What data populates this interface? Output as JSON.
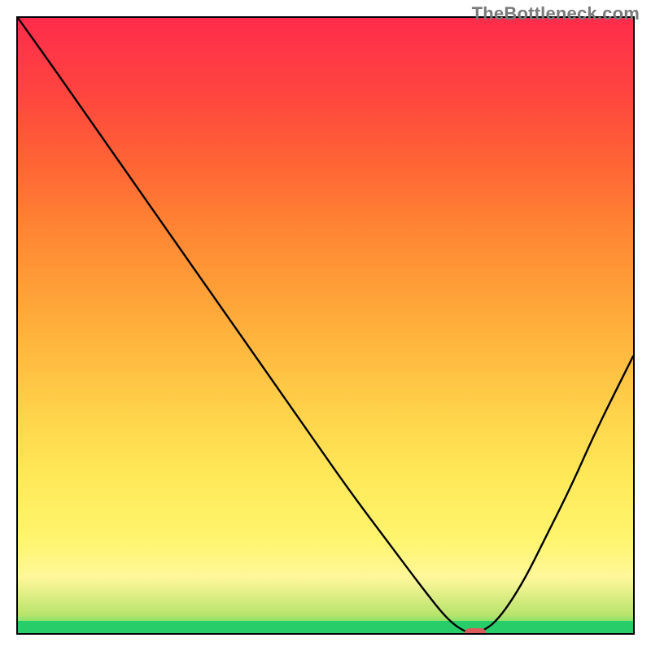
{
  "watermark": "TheBottleneck.com",
  "chart_data": {
    "type": "line",
    "title": "",
    "xlabel": "",
    "ylabel": "",
    "xlim": [
      0,
      100
    ],
    "ylim": [
      0,
      100
    ],
    "grid": false,
    "series": [
      {
        "name": "bottleneck-curve",
        "x": [
          0,
          5,
          12,
          19,
          26,
          33,
          40,
          47,
          54,
          60,
          66,
          70,
          73,
          75,
          78,
          82,
          86,
          90,
          94,
          100
        ],
        "values": [
          100,
          93,
          83,
          73,
          63,
          53,
          43,
          33,
          23,
          15,
          7,
          2,
          0,
          0,
          2,
          8,
          16,
          24,
          33,
          45
        ]
      }
    ],
    "marker": {
      "x": 74,
      "y": 0.5
    },
    "background_gradient": {
      "stops": [
        {
          "pos": 0.0,
          "color": "#27cd68"
        },
        {
          "pos": 0.02,
          "color": "#27cd68"
        },
        {
          "pos": 0.03,
          "color": "#b8e46c"
        },
        {
          "pos": 0.09,
          "color": "#fff79a"
        },
        {
          "pos": 0.26,
          "color": "#ffe857"
        },
        {
          "pos": 0.46,
          "color": "#ffb93f"
        },
        {
          "pos": 0.66,
          "color": "#ff8433"
        },
        {
          "pos": 0.88,
          "color": "#ff443f"
        },
        {
          "pos": 1.0,
          "color": "#ff2c4c"
        }
      ]
    }
  }
}
